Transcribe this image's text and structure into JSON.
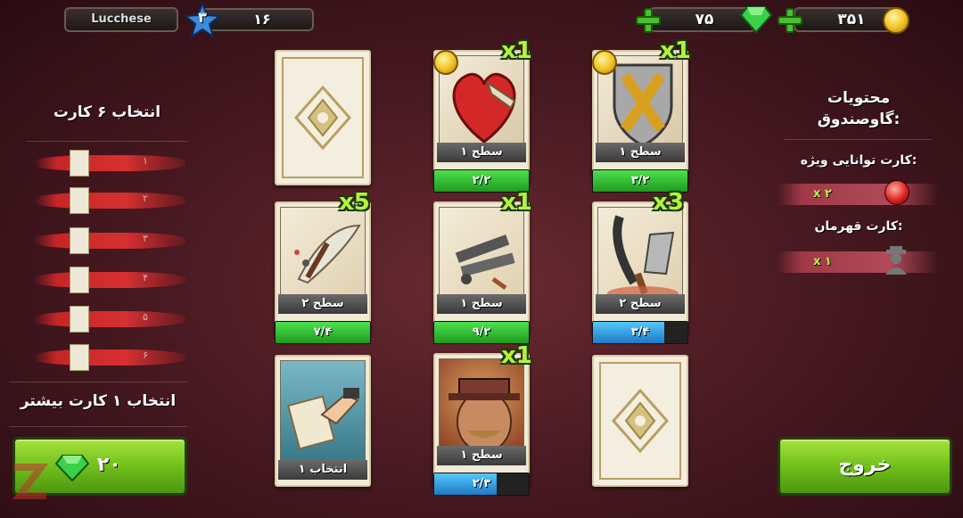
{
  "top": {
    "player_name": "Lucchese",
    "level": "۳",
    "xp_value": "۱۶",
    "gems": "۷۵",
    "coins": "۳۵۱"
  },
  "left": {
    "select_title": "انتخاب ۶ کارت",
    "slots": [
      "۱",
      "۲",
      "۳",
      "۴",
      "۵",
      "۶"
    ],
    "more_title": "انتخاب ۱ کارت بیشتر",
    "buy_price": "۲۰"
  },
  "right": {
    "contents_title_1": "محتویات",
    "contents_title_2": "گاوصندوق:",
    "special_label": "کارت توانایی ویژه:",
    "special_count": "x ۲",
    "hero_label": "کارت قهرمان:",
    "hero_count": "x ۱",
    "exit_label": "خروج"
  },
  "cards": [
    {
      "id": "back-1",
      "type": "back"
    },
    {
      "id": "heart",
      "level": "سطح ۱",
      "progress": "۲/۲",
      "mult": "x1",
      "bar": "green",
      "coin": true
    },
    {
      "id": "shield",
      "level": "سطح ۱",
      "progress": "۳/۲",
      "mult": "x1",
      "bar": "green",
      "coin": true
    },
    {
      "id": "crossbow",
      "level": "سطح ۲",
      "progress": "۷/۴",
      "mult": "x5",
      "bar": "green"
    },
    {
      "id": "guns",
      "level": "سطح ۱",
      "progress": "۹/۲",
      "mult": "x1",
      "bar": "green"
    },
    {
      "id": "blades",
      "level": "سطح ۲",
      "progress": "۳/۴",
      "mult": "x3",
      "bar": "blue",
      "fill": 0.75
    },
    {
      "id": "select",
      "level": "۱ انتخاب"
    },
    {
      "id": "gangster",
      "level": "سطح ۱",
      "progress": "۲/۳",
      "mult": "x1",
      "bar": "blue",
      "fill": 0.66
    },
    {
      "id": "back-2",
      "type": "back"
    }
  ],
  "colors": {
    "accent_green": "#6cbc1a",
    "gem": "#3cd04a",
    "coin": "#f0c020",
    "bar_blue": "#1e7ac8"
  }
}
